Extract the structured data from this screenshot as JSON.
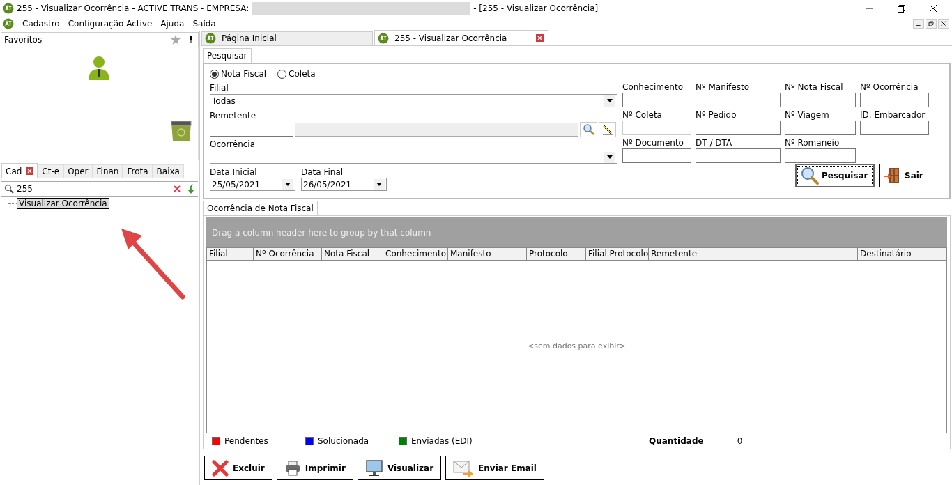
{
  "window": {
    "title_left": "255 - Visualizar Ocorrência - ACTIVE TRANS - EMPRESA:",
    "title_right": "- [255 - Visualizar Ocorrência]"
  },
  "menu": [
    "Cadastro",
    "Configuração Active",
    "Ajuda",
    "Saída"
  ],
  "favorites": {
    "title": "Favoritos"
  },
  "left_tabs": [
    {
      "label": "Cad",
      "selected": true,
      "closable": true
    },
    {
      "label": "Ct-e",
      "selected": false,
      "closable": false
    },
    {
      "label": "Oper",
      "selected": false,
      "closable": false
    },
    {
      "label": "Finan",
      "selected": false,
      "closable": false
    },
    {
      "label": "Frota",
      "selected": false,
      "closable": false
    },
    {
      "label": "Baixa",
      "selected": false,
      "closable": false
    }
  ],
  "menu_search": {
    "value": "255"
  },
  "tree": [
    {
      "label": "Visualizar Ocorrência",
      "selected": true
    }
  ],
  "doc_tabs": [
    {
      "label": "Página Inicial",
      "selected": false
    },
    {
      "label": "255 - Visualizar Ocorrência",
      "selected": true
    }
  ],
  "form_tab": "Pesquisar",
  "radios": [
    {
      "label": "Nota Fiscal",
      "selected": true
    },
    {
      "label": "Coleta",
      "selected": false
    }
  ],
  "filial": {
    "label": "Filial",
    "value": "Todas"
  },
  "remetente": {
    "label": "Remetente"
  },
  "ocorrencia": {
    "label": "Ocorrência"
  },
  "dates": [
    {
      "label": "Data Inicial",
      "value": "25/05/2021"
    },
    {
      "label": "Data Final",
      "value": "26/05/2021"
    }
  ],
  "fields": [
    {
      "label": "Conhecimento",
      "disabled": false
    },
    {
      "label": "Nº Manifesto",
      "disabled": false
    },
    {
      "label": "Nº Nota Fiscal",
      "disabled": false
    },
    {
      "label": "Nº Ocorrência",
      "disabled": false
    },
    {
      "label": "Nº Coleta",
      "disabled": true
    },
    {
      "label": "Nº Pedido",
      "disabled": false
    },
    {
      "label": "Nº Viagem",
      "disabled": false
    },
    {
      "label": "ID. Embarcador",
      "disabled": false
    },
    {
      "label": "Nº Documento",
      "disabled": false
    },
    {
      "label": "DT / DTA",
      "disabled": false
    },
    {
      "label": "Nº Romaneio",
      "disabled": false
    }
  ],
  "search_buttons": [
    {
      "label": "Pesquisar",
      "kind": "search",
      "focused": true
    },
    {
      "label": "Sair",
      "kind": "exit",
      "focused": false
    }
  ],
  "grid_tab": "Ocorrência de Nota Fiscal",
  "group_hint": "Drag a column header here to group by that column",
  "columns": [
    "Filial",
    "Nº Ocorrência",
    "Nota Fiscal",
    "Conhecimento",
    "Manifesto",
    "Protocolo",
    "Filial Protocolo",
    "Remetente",
    "Destinatário"
  ],
  "empty_text": "<sem dados para exibir>",
  "legend": [
    {
      "label": "Pendentes",
      "color": "#ff0000"
    },
    {
      "label": "Solucionada",
      "color": "#0000ff"
    },
    {
      "label": "Enviadas (EDI)",
      "color": "#008000"
    }
  ],
  "quantity": {
    "label": "Quantidade",
    "value": "0"
  },
  "actions": [
    {
      "label": "Excluir",
      "kind": "delete"
    },
    {
      "label": "Imprimir",
      "kind": "print"
    },
    {
      "label": "Visualizar",
      "kind": "view"
    },
    {
      "label": "Enviar Email",
      "kind": "email"
    }
  ]
}
